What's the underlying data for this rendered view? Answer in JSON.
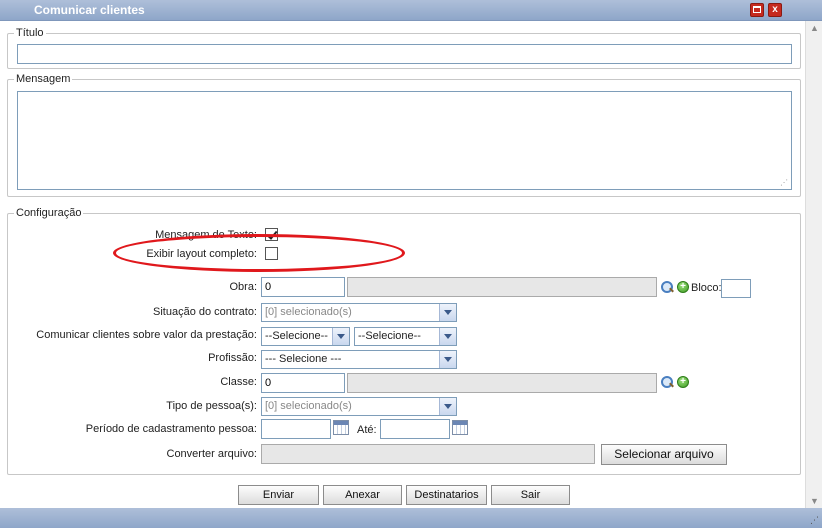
{
  "window": {
    "title": "Comunicar clientes",
    "maximize_icon": "maximize-icon",
    "close_icon": "close-icon",
    "close_glyph": "x"
  },
  "titulo": {
    "legend": "Título",
    "value": ""
  },
  "mensagem": {
    "legend": "Mensagem",
    "value": ""
  },
  "configuracao": {
    "legend": "Configuração",
    "mensagem_texto_label": "Mensagem de Texto:",
    "mensagem_texto_checked": true,
    "exibir_layout_label": "Exibir layout completo:",
    "exibir_layout_checked": false,
    "obra_label": "Obra:",
    "obra_value": "0",
    "obra_desc": "",
    "bloco_label": "Bloco:",
    "bloco_value": "",
    "situacao_label": "Situação do contrato:",
    "situacao_value": "[0] selecionado(s)",
    "prestacao_label": "Comunicar clientes sobre valor da prestação:",
    "prestacao_select1": "--Selecione--",
    "prestacao_select2": "--Selecione--",
    "profissao_label": "Profissão:",
    "profissao_value": "--- Selecione ---",
    "classe_label": "Classe:",
    "classe_value": "0",
    "classe_desc": "",
    "tipo_pessoa_label": "Tipo de pessoa(s):",
    "tipo_pessoa_value": "[0] selecionado(s)",
    "periodo_label": "Período de cadastramento pessoa:",
    "periodo_de": "",
    "ate_label": "Até:",
    "periodo_ate": "",
    "converter_label": "Converter arquivo:",
    "converter_value": "",
    "selecionar_arquivo": "Selecionar arquivo"
  },
  "actions": {
    "enviar": "Enviar",
    "anexar": "Anexar",
    "destinatarios": "Destinatarios",
    "sair": "Sair"
  },
  "colors": {
    "highlight": "#e0181c",
    "titlebar": "#8ea6c9"
  }
}
